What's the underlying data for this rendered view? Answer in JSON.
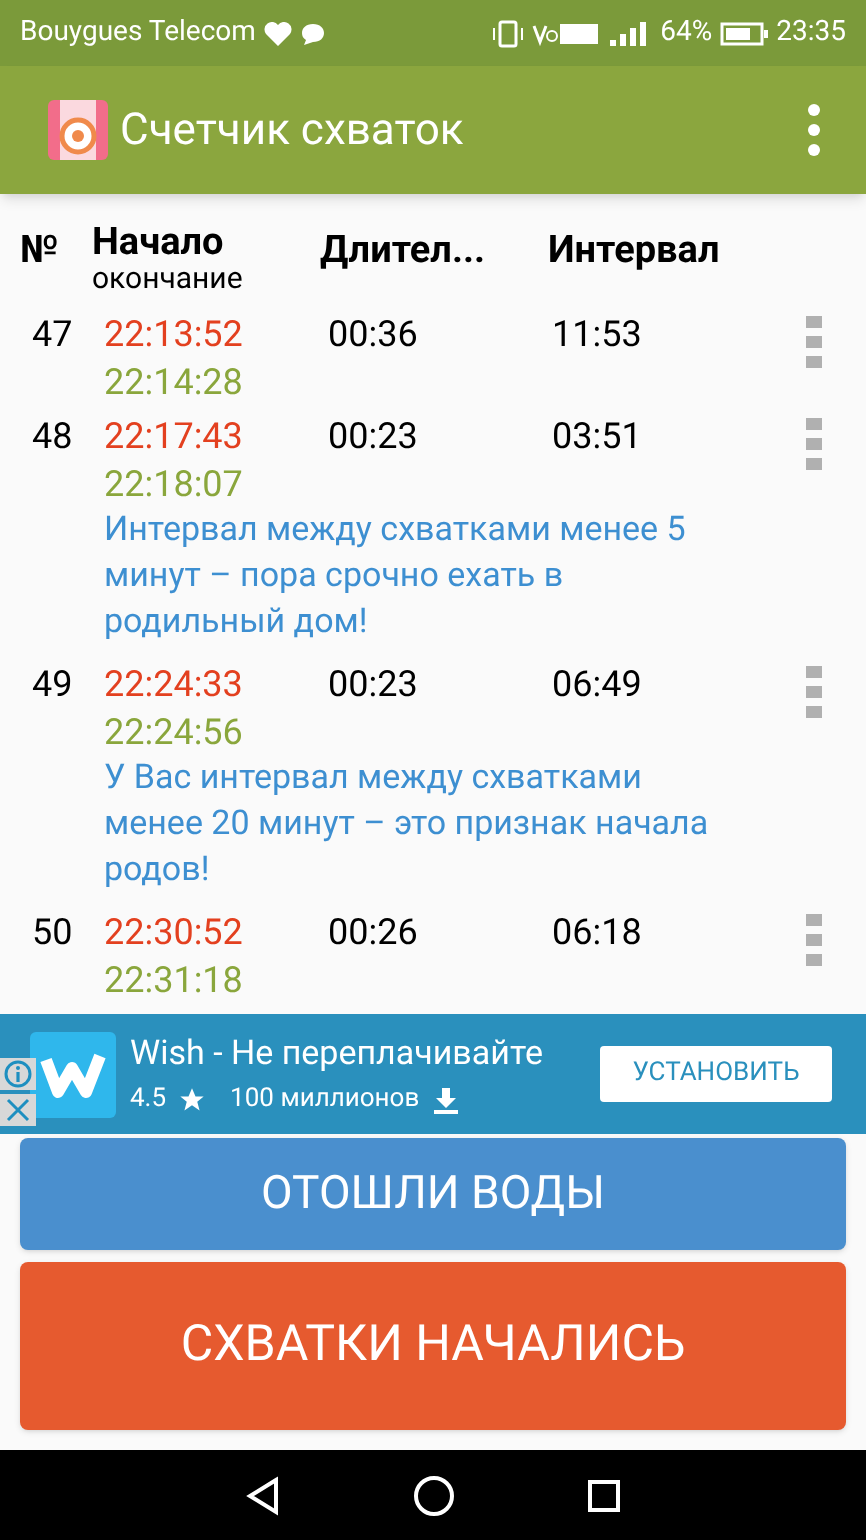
{
  "status_bar": {
    "carrier": "Bouygues Telecom",
    "battery": "64%",
    "time": "23:35"
  },
  "app_bar": {
    "title": "Счетчик схваток"
  },
  "table": {
    "columns": [
      "№",
      "Начало",
      "Длител...",
      "Интервал"
    ],
    "subheading": "окончание",
    "rows": [
      {
        "number": "47",
        "start": "22:13:52",
        "end": "22:14:28",
        "duration": "00:36",
        "interval": "11:53"
      },
      {
        "number": "48",
        "start": "22:17:43",
        "end": "22:18:07",
        "duration": "00:23",
        "interval": "03:51",
        "message": "Интервал между схватками менее 5 минут – пора срочно ехать в родильный дом!"
      },
      {
        "number": "49",
        "start": "22:24:33",
        "end": "22:24:56",
        "duration": "00:23",
        "interval": "06:49",
        "message": "У Вас интервал между схватками менее 20 минут – это признак начала родов!"
      },
      {
        "number": "50",
        "start": "22:30:52",
        "end": "22:31:18",
        "duration": "00:26",
        "interval": "06:18"
      }
    ]
  },
  "ad": {
    "title": "Wish - Не переплачивайте",
    "rating": "4.5",
    "downloads": "100 миллионов",
    "button": "УСТАНОВИТЬ"
  },
  "buttons": [
    {
      "label": "ОТОШЛИ ВОДЫ",
      "color": "#4a8fce"
    },
    {
      "label": "СХВАТКИ НАЧАЛИСЬ",
      "color": "#e65a2f"
    }
  ]
}
